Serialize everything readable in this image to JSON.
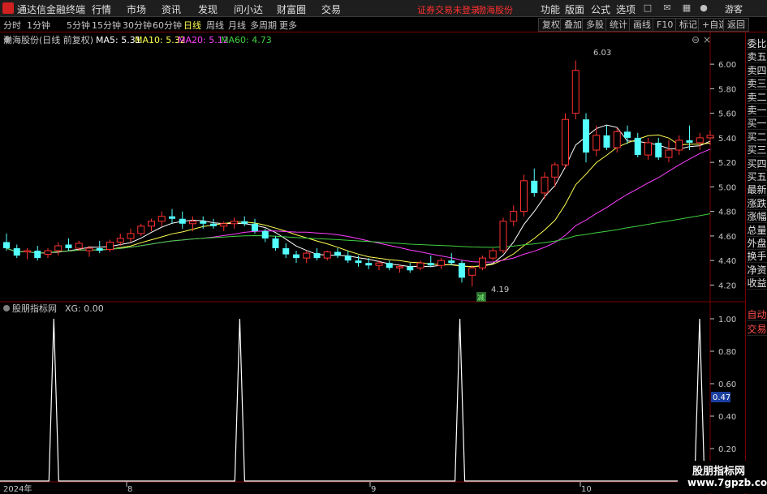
{
  "titlebar": {
    "title": "通达信金融终端",
    "menus": [
      "行情",
      "市场",
      "资讯",
      "发现",
      "问小达",
      "财富圈",
      "交易"
    ],
    "alert": "证券交易未登录",
    "stock_name": "渤海股份",
    "right_menus": [
      "功能",
      "版面",
      "公式",
      "选项"
    ],
    "user": "游客"
  },
  "toolbar": {
    "tabs": [
      "分时",
      "1分钟",
      "5分钟",
      "15分钟",
      "30分钟",
      "60分钟",
      "日线",
      "周线",
      "月线",
      "多周期",
      "更多"
    ],
    "active_tab": "日线",
    "buttons": [
      "复权",
      "叠加",
      "多股",
      "统计",
      "画线",
      "F10",
      "标记",
      "+自选",
      "返回"
    ]
  },
  "main_chart": {
    "label": "渤海股份(日线 前复权)",
    "ma": [
      {
        "name": "MA5",
        "value": "5.31",
        "color": "#ffffff"
      },
      {
        "name": "MA10",
        "value": "5.32",
        "color": "#ffff50"
      },
      {
        "name": "MA20",
        "value": "5.12",
        "color": "#ff40ff"
      },
      {
        "name": "MA60",
        "value": "4.73",
        "color": "#40d040"
      }
    ],
    "high_label": "6.03",
    "low_label": "4.19",
    "marker": "减",
    "y_ticks": [
      "6.00",
      "5.80",
      "5.60",
      "5.40",
      "5.20",
      "5.00",
      "4.80",
      "4.60",
      "4.40",
      "4.20"
    ]
  },
  "indicator": {
    "label": "股朋指标网",
    "value_label": "XG: 0.00",
    "y_ticks": [
      "1.00",
      "0.80",
      "0.60",
      "0.40",
      "0.20"
    ],
    "cursor_value": "0.47",
    "signals": [
      0,
      0,
      0,
      0,
      0,
      0,
      0,
      0,
      0,
      0,
      0,
      1,
      0,
      0,
      0,
      0,
      0,
      0,
      0,
      0,
      0,
      0,
      0,
      0,
      0,
      0,
      0,
      0,
      0,
      0,
      0,
      0,
      0,
      0,
      0,
      0,
      0,
      0,
      0,
      0,
      0,
      0,
      0,
      0,
      0,
      0,
      0,
      0,
      0,
      1,
      0,
      0,
      0,
      0,
      0,
      0,
      0,
      0,
      0,
      0,
      0,
      0,
      0,
      0,
      0,
      0,
      0,
      0,
      0,
      0,
      0,
      0,
      0,
      0,
      0,
      0,
      0,
      0,
      0,
      0,
      0,
      0,
      0,
      0,
      0,
      0,
      0,
      0,
      0,
      0,
      0,
      0,
      0,
      0,
      1,
      0,
      0,
      0,
      0,
      0,
      0,
      0,
      0,
      0,
      0,
      0,
      0,
      0,
      0,
      0,
      0,
      0,
      0,
      0,
      0,
      0,
      0,
      0,
      0,
      0,
      0,
      0,
      0,
      0,
      0,
      0,
      0,
      0,
      0,
      0,
      0,
      0,
      0,
      0,
      0,
      0,
      0,
      0,
      0,
      0,
      0,
      0,
      0,
      1,
      0
    ]
  },
  "x_axis": {
    "labels": [
      "2024年",
      "8",
      "9",
      "10"
    ]
  },
  "sidebar": {
    "items": [
      "委比",
      "卖五",
      "卖四",
      "卖三",
      "卖二",
      "卖一",
      "买一",
      "买二",
      "买三",
      "买四",
      "买五",
      "最新",
      "涨跌",
      "涨幅",
      "总量",
      "外盘",
      "换手",
      "净资",
      "收益",
      "自动",
      "交易"
    ]
  },
  "watermark": {
    "line1": "股朋指标网",
    "line2": "www.7gpzb.com"
  },
  "colors": {
    "up": "#ff3030",
    "down": "#54ffff",
    "grid": "#7a0000",
    "text": "#c0c0c0"
  },
  "chart_data": {
    "type": "candlestick",
    "ylim": [
      4.13,
      6.1
    ],
    "candles": [
      {
        "o": 4.55,
        "h": 4.62,
        "l": 4.48,
        "c": 4.5
      },
      {
        "o": 4.5,
        "h": 4.53,
        "l": 4.42,
        "c": 4.44
      },
      {
        "o": 4.47,
        "h": 4.5,
        "l": 4.41,
        "c": 4.48
      },
      {
        "o": 4.48,
        "h": 4.52,
        "l": 4.4,
        "c": 4.42
      },
      {
        "o": 4.45,
        "h": 4.5,
        "l": 4.42,
        "c": 4.48
      },
      {
        "o": 4.48,
        "h": 4.55,
        "l": 4.44,
        "c": 4.52
      },
      {
        "o": 4.53,
        "h": 4.58,
        "l": 4.48,
        "c": 4.5
      },
      {
        "o": 4.5,
        "h": 4.56,
        "l": 4.48,
        "c": 4.54
      },
      {
        "o": 4.48,
        "h": 4.52,
        "l": 4.43,
        "c": 4.5
      },
      {
        "o": 4.5,
        "h": 4.56,
        "l": 4.46,
        "c": 4.48
      },
      {
        "o": 4.49,
        "h": 4.57,
        "l": 4.47,
        "c": 4.55
      },
      {
        "o": 4.55,
        "h": 4.62,
        "l": 4.52,
        "c": 4.58
      },
      {
        "o": 4.58,
        "h": 4.66,
        "l": 4.55,
        "c": 4.62
      },
      {
        "o": 4.62,
        "h": 4.7,
        "l": 4.6,
        "c": 4.68
      },
      {
        "o": 4.68,
        "h": 4.74,
        "l": 4.64,
        "c": 4.72
      },
      {
        "o": 4.72,
        "h": 4.8,
        "l": 4.68,
        "c": 4.76
      },
      {
        "o": 4.76,
        "h": 4.82,
        "l": 4.7,
        "c": 4.74
      },
      {
        "o": 4.74,
        "h": 4.8,
        "l": 4.66,
        "c": 4.7
      },
      {
        "o": 4.7,
        "h": 4.76,
        "l": 4.64,
        "c": 4.72
      },
      {
        "o": 4.72,
        "h": 4.76,
        "l": 4.66,
        "c": 4.7
      },
      {
        "o": 4.7,
        "h": 4.74,
        "l": 4.66,
        "c": 4.68
      },
      {
        "o": 4.68,
        "h": 4.72,
        "l": 4.64,
        "c": 4.7
      },
      {
        "o": 4.7,
        "h": 4.75,
        "l": 4.66,
        "c": 4.72
      },
      {
        "o": 4.72,
        "h": 4.76,
        "l": 4.68,
        "c": 4.7
      },
      {
        "o": 4.7,
        "h": 4.74,
        "l": 4.62,
        "c": 4.64
      },
      {
        "o": 4.64,
        "h": 4.66,
        "l": 4.55,
        "c": 4.58
      },
      {
        "o": 4.58,
        "h": 4.6,
        "l": 4.48,
        "c": 4.5
      },
      {
        "o": 4.5,
        "h": 4.54,
        "l": 4.42,
        "c": 4.45
      },
      {
        "o": 4.45,
        "h": 4.48,
        "l": 4.38,
        "c": 4.42
      },
      {
        "o": 4.42,
        "h": 4.48,
        "l": 4.38,
        "c": 4.46
      },
      {
        "o": 4.46,
        "h": 4.5,
        "l": 4.4,
        "c": 4.42
      },
      {
        "o": 4.42,
        "h": 4.48,
        "l": 4.4,
        "c": 4.47
      },
      {
        "o": 4.47,
        "h": 4.5,
        "l": 4.42,
        "c": 4.44
      },
      {
        "o": 4.44,
        "h": 4.48,
        "l": 4.38,
        "c": 4.4
      },
      {
        "o": 4.4,
        "h": 4.44,
        "l": 4.35,
        "c": 4.38
      },
      {
        "o": 4.38,
        "h": 4.42,
        "l": 4.33,
        "c": 4.36
      },
      {
        "o": 4.36,
        "h": 4.4,
        "l": 4.32,
        "c": 4.38
      },
      {
        "o": 4.38,
        "h": 4.4,
        "l": 4.32,
        "c": 4.34
      },
      {
        "o": 4.34,
        "h": 4.37,
        "l": 4.3,
        "c": 4.35
      },
      {
        "o": 4.35,
        "h": 4.38,
        "l": 4.3,
        "c": 4.32
      },
      {
        "o": 4.34,
        "h": 4.4,
        "l": 4.32,
        "c": 4.38
      },
      {
        "o": 4.38,
        "h": 4.44,
        "l": 4.35,
        "c": 4.36
      },
      {
        "o": 4.36,
        "h": 4.42,
        "l": 4.33,
        "c": 4.4
      },
      {
        "o": 4.4,
        "h": 4.46,
        "l": 4.36,
        "c": 4.38
      },
      {
        "o": 4.38,
        "h": 4.4,
        "l": 4.22,
        "c": 4.26
      },
      {
        "o": 4.28,
        "h": 4.36,
        "l": 4.19,
        "c": 4.34
      },
      {
        "o": 4.34,
        "h": 4.44,
        "l": 4.32,
        "c": 4.42
      },
      {
        "o": 4.42,
        "h": 4.5,
        "l": 4.4,
        "c": 4.48
      },
      {
        "o": 4.48,
        "h": 4.75,
        "l": 4.46,
        "c": 4.72
      },
      {
        "o": 4.72,
        "h": 4.85,
        "l": 4.68,
        "c": 4.8
      },
      {
        "o": 4.8,
        "h": 5.1,
        "l": 4.76,
        "c": 5.05
      },
      {
        "o": 5.05,
        "h": 5.15,
        "l": 4.92,
        "c": 4.95
      },
      {
        "o": 4.95,
        "h": 5.12,
        "l": 4.9,
        "c": 5.08
      },
      {
        "o": 5.08,
        "h": 5.2,
        "l": 5.0,
        "c": 5.18
      },
      {
        "o": 5.18,
        "h": 5.6,
        "l": 5.15,
        "c": 5.55
      },
      {
        "o": 5.6,
        "h": 6.03,
        "l": 5.55,
        "c": 5.95
      },
      {
        "o": 5.55,
        "h": 5.6,
        "l": 5.2,
        "c": 5.28
      },
      {
        "o": 5.3,
        "h": 5.5,
        "l": 5.25,
        "c": 5.42
      },
      {
        "o": 5.42,
        "h": 5.5,
        "l": 5.3,
        "c": 5.32
      },
      {
        "o": 5.32,
        "h": 5.48,
        "l": 5.28,
        "c": 5.45
      },
      {
        "o": 5.45,
        "h": 5.5,
        "l": 5.35,
        "c": 5.4
      },
      {
        "o": 5.4,
        "h": 5.44,
        "l": 5.24,
        "c": 5.26
      },
      {
        "o": 5.26,
        "h": 5.4,
        "l": 5.22,
        "c": 5.36
      },
      {
        "o": 5.36,
        "h": 5.4,
        "l": 5.22,
        "c": 5.24
      },
      {
        "o": 5.24,
        "h": 5.38,
        "l": 5.2,
        "c": 5.3
      },
      {
        "o": 5.3,
        "h": 5.42,
        "l": 5.26,
        "c": 5.38
      },
      {
        "o": 5.38,
        "h": 5.5,
        "l": 5.3,
        "c": 5.36
      },
      {
        "o": 5.36,
        "h": 5.44,
        "l": 5.3,
        "c": 5.4
      },
      {
        "o": 5.4,
        "h": 5.46,
        "l": 5.34,
        "c": 5.42
      }
    ]
  }
}
